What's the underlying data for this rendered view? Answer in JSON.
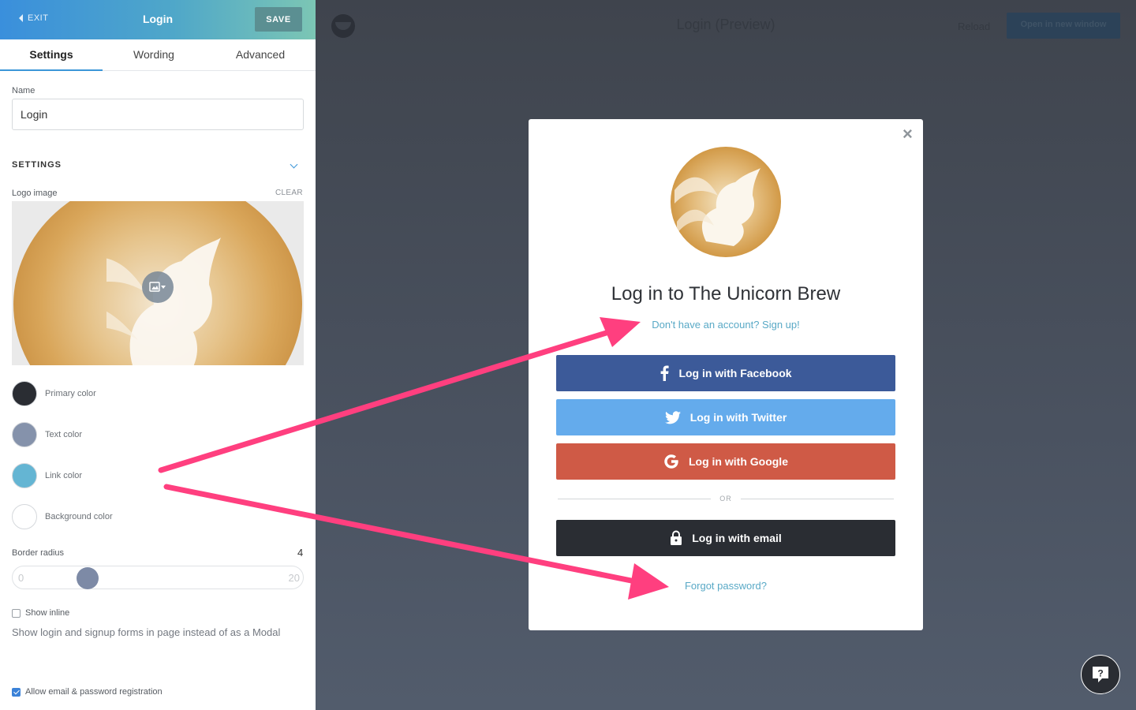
{
  "editor": {
    "exit_label": "EXIT",
    "title": "Login",
    "save_label": "SAVE",
    "tabs": [
      {
        "label": "Settings",
        "active": true
      },
      {
        "label": "Wording",
        "active": false
      },
      {
        "label": "Advanced",
        "active": false
      }
    ],
    "name_label": "Name",
    "name_value": "Login",
    "section_title": "SETTINGS",
    "logo_label": "Logo image",
    "clear_label": "CLEAR",
    "colors": [
      {
        "label": "Primary color",
        "value": "#2a2d33"
      },
      {
        "label": "Text color",
        "value": "#8592ab"
      },
      {
        "label": "Link color",
        "value": "#64b5d3"
      },
      {
        "label": "Background color",
        "value": "#ffffff"
      }
    ],
    "border_radius": {
      "label": "Border radius",
      "value": "4",
      "min": "0",
      "max": "20"
    },
    "show_inline": {
      "label": "Show inline",
      "checked": false,
      "help": "Show login and signup forms in page instead of as a Modal"
    },
    "allow_email": {
      "label": "Allow email & password registration",
      "checked": true
    }
  },
  "preview": {
    "title": "Login (Preview)",
    "reload_label": "Reload",
    "open_label": "Open in new window",
    "modal": {
      "close_glyph": "×",
      "heading": "Log in to The Unicorn Brew",
      "signup_link": "Don't have an account? Sign up!",
      "facebook_label": "Log in with Facebook",
      "twitter_label": "Log in with Twitter",
      "google_label": "Log in with Google",
      "or_label": "OR",
      "email_label": "Log in with email",
      "forgot_link": "Forgot password?"
    },
    "colors": {
      "facebook": "#3c5a99",
      "twitter": "#64abec",
      "google": "#cf5a46",
      "email": "#2a2d33",
      "link": "#59a9c6",
      "annotation_arrow": "#ff3f7f"
    }
  }
}
